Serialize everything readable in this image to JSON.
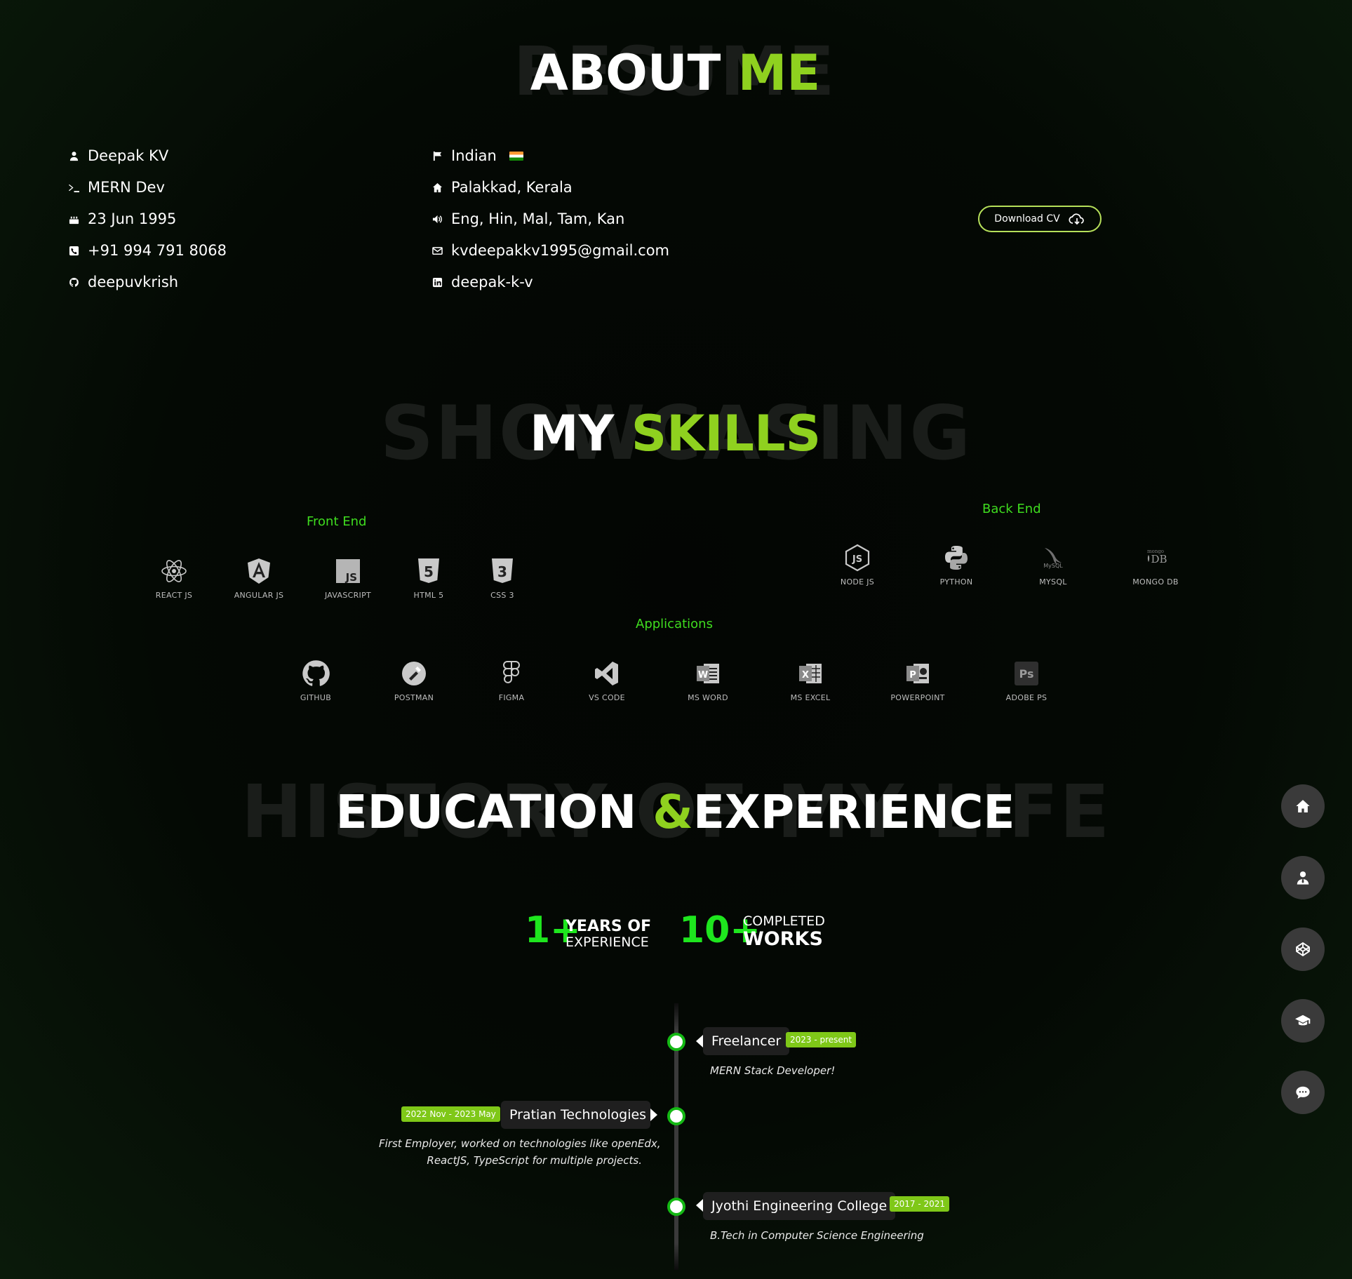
{
  "about": {
    "bg_word": "RESUME",
    "title_white": "ABOUT",
    "title_green": "ME",
    "left": [
      {
        "icon": "user-icon",
        "text": "Deepak KV"
      },
      {
        "icon": "terminal-icon",
        "text": "MERN Dev"
      },
      {
        "icon": "cake-icon",
        "text": "23 Jun 1995"
      },
      {
        "icon": "phone-icon",
        "text": "+91 994 791 8068"
      },
      {
        "icon": "github-icon",
        "text": "deepuvkrish"
      }
    ],
    "right": [
      {
        "icon": "flag-icon",
        "text": "Indian"
      },
      {
        "icon": "home-icon",
        "text": "Palakkad, Kerala"
      },
      {
        "icon": "speaker-icon",
        "text": "Eng, Hin, Mal, Tam, Kan"
      },
      {
        "icon": "mail-icon",
        "text": "kvdeepakkv1995@gmail.com"
      },
      {
        "icon": "linkedin-icon",
        "text": "deepak-k-v"
      }
    ],
    "download_label": "Download CV"
  },
  "skills": {
    "bg_word": "SHOWCASING",
    "title_white": "MY",
    "title_green": "SKILLS",
    "front_title": "Front End",
    "back_title": "Back End",
    "apps_title": "Applications",
    "front": [
      "REACT JS",
      "ANGULAR JS",
      "JAVASCRIPT",
      "HTML 5",
      "CSS 3"
    ],
    "back": [
      "NODE JS",
      "PYTHON",
      "MYSQL",
      "MONGO DB"
    ],
    "apps": [
      "GITHUB",
      "POSTMAN",
      "FIGMA",
      "VS CODE",
      "MS WORD",
      "MS EXCEL",
      "POWERPOINT",
      "ADOBE PS"
    ]
  },
  "education": {
    "bg_word": "HISTORY OF MY LIFE",
    "title_a": "EDUCATION",
    "title_amp": "&",
    "title_b": "EXPERIENCE",
    "stat1_num": "1+",
    "stat1_line1": "YEARS OF",
    "stat1_line2": "EXPERIENCE",
    "stat2_num": "10+",
    "stat2_line1": "COMPLETED",
    "stat2_line2": "WORKS",
    "timeline": [
      {
        "title": "Freelancer",
        "period": "2023 - present",
        "desc1": "MERN Stack Developer!",
        "desc2": ""
      },
      {
        "title": "Pratian Technologies",
        "period": "2022 Nov - 2023 May",
        "desc1": "First Employer, worked on technologies like openEdx,",
        "desc2": "ReactJS, TypeScript for multiple projects."
      },
      {
        "title": "Jyothi Engineering College",
        "period": "2017 - 2021",
        "desc1": "B.Tech in Computer Science Engineering",
        "desc2": ""
      }
    ]
  },
  "nav": [
    "home-icon",
    "user-icon",
    "codepen-icon",
    "graduation-cap-icon",
    "chat-icon"
  ],
  "colors": {
    "accent": "#8fd11f",
    "skill_green": "#3fdc1f",
    "stat_green": "#1ee61e",
    "badge": "#7fc818",
    "timeline_dot": "#14b814"
  }
}
